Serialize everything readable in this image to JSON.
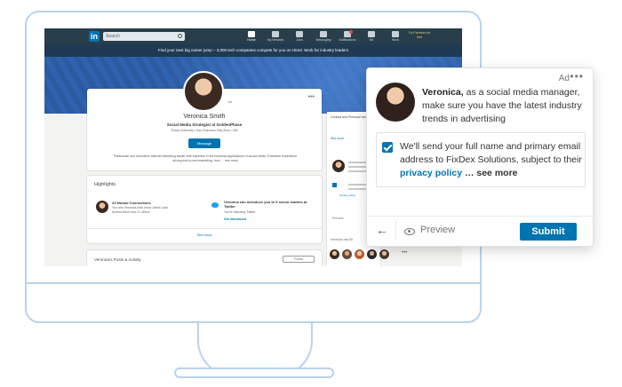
{
  "topbar": {
    "logo": "in",
    "search_placeholder": "Search",
    "nav": [
      "Home",
      "My Network",
      "Jobs",
      "Messaging",
      "Notifications",
      "Me",
      "Work"
    ],
    "premium": "Try Premium for free"
  },
  "promo": {
    "text": "Find your next big career jump – 3,000 tech companies compete for you on Hired. Work for industry leaders"
  },
  "profile": {
    "name": "Veronica Smith",
    "headline": "Social Media Strategist at GoldenPhase",
    "subline": "Rusty University • San Francisco Bay Area • 150",
    "number": "1st",
    "message_button": "Message",
    "summary": "Passionate and innovative Internet Marketing leader with expertise in the business applications of social media. Extensive experience driving end-to-end marketing, from … see more"
  },
  "highlights": {
    "title": "Highlights",
    "connections_title": "23 Mutual Connections",
    "connections_sub": "You and Veronica both know Jared Lutal, Andrea Birch and 21 others",
    "intro_title": "Veronica can introduce you to 5 senior leaders at Twitter",
    "intro_sub": "You're following Twitter",
    "intro_link": "Get introduced",
    "see_more": "See more"
  },
  "activity": {
    "title": "Veronica's Posts & Activity",
    "button": "Follow"
  },
  "rightcol": {
    "text": "Contact and Personal Info",
    "see_more": "See more",
    "policy": "privacy policy",
    "preview": "Preview",
    "footer": "Veronica has 50"
  },
  "ad": {
    "label": "Ad",
    "name": "Veronica,",
    "message": " as a social media manager, make sure you have the latest industry trends in advertising",
    "consent_text": "We'll send your full name and primary email address to FixDex Solutions, subject to their ",
    "policy_link": "privacy policy",
    "see_more": " … see more",
    "back_label": "←",
    "preview_label": "Preview",
    "submit_label": "Submit"
  },
  "colors": {
    "brand": "#0073b1",
    "navbar": "#283e4a",
    "monitor_outline": "#b9d3ea"
  }
}
